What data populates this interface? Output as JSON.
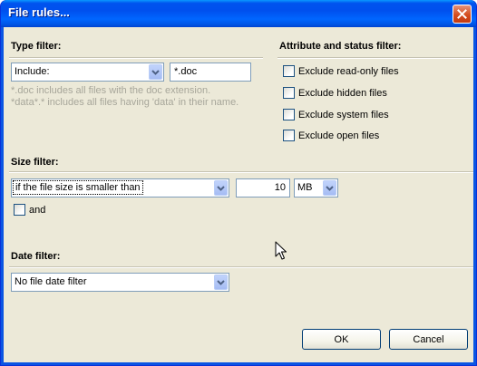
{
  "window": {
    "title": "File rules..."
  },
  "type_filter": {
    "heading": "Type filter:",
    "mode": "Include:",
    "pattern": "*.doc",
    "hint_line1": "*.doc includes all files with the doc extension.",
    "hint_line2": "*data*.* includes all files having 'data' in their name."
  },
  "attribute_filter": {
    "heading": "Attribute and status filter:",
    "options": [
      {
        "label": "Exclude read-only files",
        "checked": false
      },
      {
        "label": "Exclude hidden files",
        "checked": false
      },
      {
        "label": "Exclude system files",
        "checked": false
      },
      {
        "label": "Exclude open files",
        "checked": false
      }
    ]
  },
  "size_filter": {
    "heading": "Size filter:",
    "condition": "if the file size is smaller than",
    "value": "10",
    "unit": "MB",
    "and_label": "and",
    "and_checked": false
  },
  "date_filter": {
    "heading": "Date filter:",
    "value": "No file date filter"
  },
  "buttons": {
    "ok": "OK",
    "cancel": "Cancel"
  }
}
